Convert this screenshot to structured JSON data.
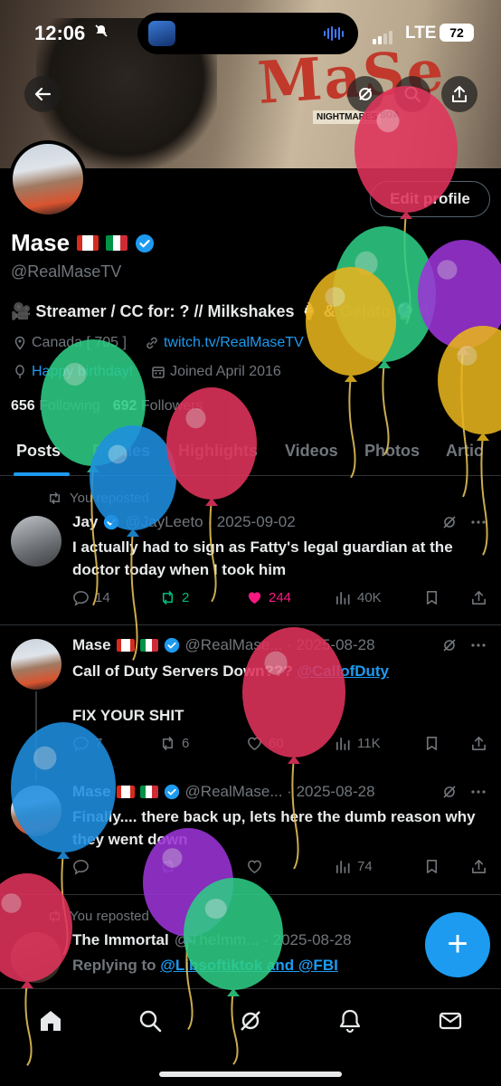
{
  "status": {
    "time": "12:06",
    "network": "LTE",
    "battery": "72"
  },
  "banner": {
    "logo_text": "MaSe",
    "tags": [
      "NIGHTMARES",
      "SOA"
    ]
  },
  "profile": {
    "name": "Mase",
    "handle": "@RealMaseTV",
    "bio": "🎥 Streamer / CC for: ? // Milkshakes 🍦 & Gelato 🔮 \\\\",
    "location": "Canada [ 705 ]",
    "website": "twitch.tv/RealMaseTV",
    "birthday": "Happy birthday!",
    "joined": "Joined April 2016",
    "following_count": "656",
    "following_label": "Following",
    "followers_count": "692",
    "followers_label": "Followers",
    "edit_label": "Edit profile"
  },
  "tabs": [
    "Posts",
    "Replies",
    "Highlights",
    "Videos",
    "Photos",
    "Artic"
  ],
  "posts": [
    {
      "repost_label": "You reposted",
      "name": "Jay",
      "meta": "@JayLeeto · 2025-09-02",
      "text": "I actually had to sign as Fatty's legal guardian at the doctor today when I took him",
      "replies": "14",
      "reposts": "2",
      "likes": "244",
      "views": "40K"
    },
    {
      "name": "Mase",
      "meta": "@RealMase... · 2025-08-28",
      "text_line1": "Call of Duty Servers Down??? ",
      "mention": "@CallofDuty",
      "text_line2": "FIX YOUR SHIT",
      "replies": "7",
      "reposts": "6",
      "likes": "60",
      "views": "11K"
    },
    {
      "name": "Mase",
      "meta": "@RealMase... · 2025-08-28",
      "text": "Finally.... there back up, lets here the dumb reason why they went down",
      "views": "74"
    },
    {
      "repost_label": "You reposted",
      "name": "The Immortal",
      "meta": "@TheImm... · 2025-08-28",
      "replying_prefix": "Replying to ",
      "replying_to": "@Libsoftiktok and @FBI"
    }
  ],
  "colors": {
    "accent": "#1d9bf0",
    "like": "#f91880",
    "repost": "#00ba7c",
    "muted": "#71767b"
  },
  "balloons": [
    {
      "color": "#e0345c"
    },
    {
      "color": "#2ecc85"
    },
    {
      "color": "#9b34d6"
    },
    {
      "color": "#e8b41e"
    },
    {
      "color": "#e8b41e"
    },
    {
      "color": "#2ecc85"
    },
    {
      "color": "#1f8fe0"
    },
    {
      "color": "#e0345c"
    },
    {
      "color": "#e0345c"
    },
    {
      "color": "#1f8fe0"
    },
    {
      "color": "#9b34d6"
    },
    {
      "color": "#2ecc85"
    },
    {
      "color": "#e0345c"
    }
  ]
}
